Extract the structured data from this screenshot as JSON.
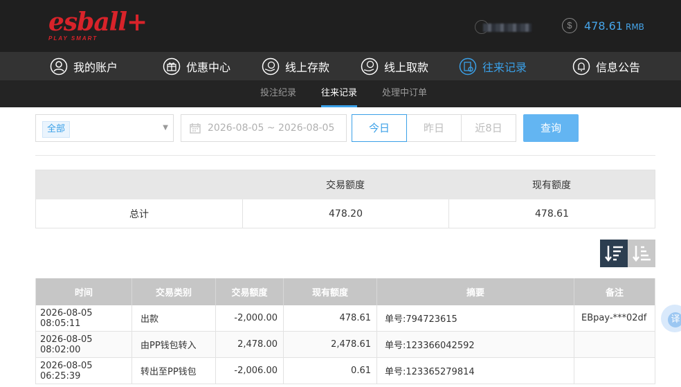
{
  "header": {
    "logo_main": "esball+",
    "logo_sub": "PLAY SMART",
    "balance_value": "478.61",
    "balance_unit": "RMB",
    "balance_icon": "dollar-coin-icon"
  },
  "main_nav": [
    {
      "label": "我的账户",
      "icon": "user-icon"
    },
    {
      "label": "优惠中心",
      "icon": "gift-icon"
    },
    {
      "label": "线上存款",
      "icon": "deposit-icon"
    },
    {
      "label": "线上取款",
      "icon": "withdraw-icon"
    },
    {
      "label": "往来记录",
      "icon": "records-icon",
      "active": true
    },
    {
      "label": "信息公告",
      "icon": "bell-icon"
    }
  ],
  "sub_nav": [
    {
      "label": "投注纪录"
    },
    {
      "label": "往来记录",
      "active": true
    },
    {
      "label": "处理中订单"
    }
  ],
  "filter": {
    "type_selected": "全部",
    "date_range": "2026-08-05 ~ 2026-08-05",
    "quick_ranges": [
      "今日",
      "昨日",
      "近8日"
    ],
    "active_range": "今日",
    "query_label": "查询"
  },
  "summary": {
    "headers": [
      "",
      "交易额度",
      "现有额度"
    ],
    "row": [
      "总计",
      "478.20",
      "478.61"
    ]
  },
  "records": {
    "headers": [
      "时间",
      "交易类别",
      "交易额度",
      "现有额度",
      "摘要",
      "备注"
    ],
    "rows": [
      [
        "2026-08-05 08:05:11",
        "出款",
        "-2,000.00",
        "478.61",
        "单号:794723615",
        "EBpay-***02df"
      ],
      [
        "2026-08-05 08:02:00",
        "由PP钱包转入",
        "2,478.00",
        "2,478.61",
        "单号:123366042592",
        ""
      ],
      [
        "2026-08-05 06:25:39",
        "转出至PP钱包",
        "-2,006.00",
        "0.61",
        "单号:123365279814",
        ""
      ]
    ]
  },
  "colors": {
    "accent": "#3aa0e8",
    "header_bg": "#1f1f1f",
    "nav_bg": "#333333",
    "logo_red": "#d8232a"
  },
  "translate_button": "译"
}
